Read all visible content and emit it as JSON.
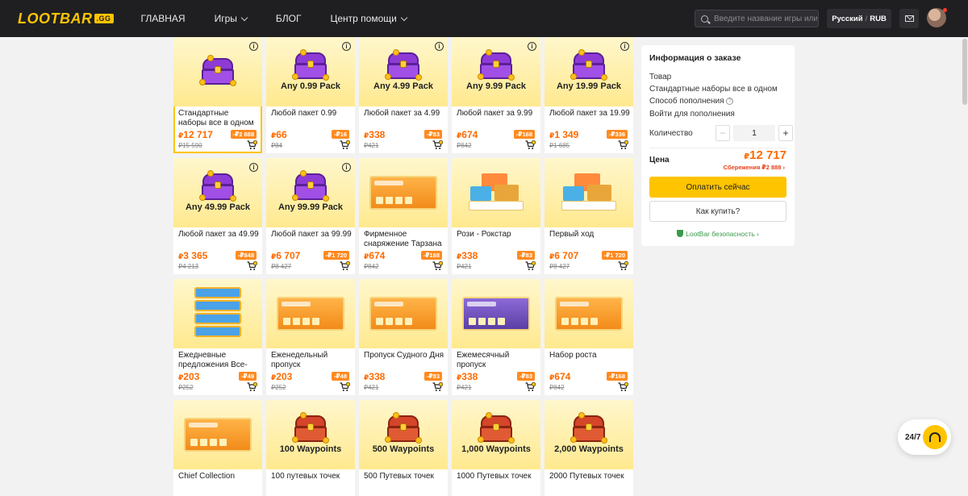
{
  "header": {
    "logo": "LOOTBAR",
    "logo_badge": ".GG",
    "nav": [
      {
        "label": "ГЛАВНАЯ",
        "dropdown": false
      },
      {
        "label": "Игры",
        "dropdown": true
      },
      {
        "label": "БЛОГ",
        "dropdown": false
      },
      {
        "label": "Центр помощи",
        "dropdown": true
      }
    ],
    "search_placeholder": "Введите название игры или тс",
    "language": "Русский",
    "currency": "RUB"
  },
  "products": [
    {
      "name": "Стандартные наборы все в одном",
      "price": "12 717",
      "discount": "-₽2 888",
      "old": "₽15 590",
      "art": "chest",
      "label": "",
      "selected": true
    },
    {
      "name": "Любой пакет 0.99",
      "price": "66",
      "discount": "-₽16",
      "old": "₽84",
      "art": "chest",
      "label": "Any 0.99 Pack"
    },
    {
      "name": "Любой пакет за 4.99",
      "price": "338",
      "discount": "-₽83",
      "old": "₽421",
      "art": "chest",
      "label": "Any 4.99 Pack"
    },
    {
      "name": "Любой пакет за 9.99",
      "price": "674",
      "discount": "-₽168",
      "old": "₽842",
      "art": "chest",
      "label": "Any 9.99 Pack"
    },
    {
      "name": "Любой пакет за 19.99",
      "price": "1 349",
      "discount": "-₽336",
      "old": "₽1 685",
      "art": "chest",
      "label": "Any 19.99 Pack"
    },
    {
      "name": "Любой пакет за 49.99",
      "price": "3 365",
      "discount": "-₽848",
      "old": "₽4 213",
      "art": "chest",
      "label": "Any 49.99 Pack"
    },
    {
      "name": "Любой пакет за 99.99",
      "price": "6 707",
      "discount": "-₽1 720",
      "old": "₽8 427",
      "art": "chest",
      "label": "Any 99.99 Pack"
    },
    {
      "name": "Фирменное снаряжение Тарзана",
      "price": "674",
      "discount": "-₽168",
      "old": "₽842",
      "art": "banner",
      "label": ""
    },
    {
      "name": "Рози - Рокстар",
      "price": "338",
      "discount": "-₽83",
      "old": "₽421",
      "art": "gifts",
      "label": ""
    },
    {
      "name": "Первый ход",
      "price": "6 707",
      "discount": "-₽1 720",
      "old": "₽8 427",
      "art": "gifts",
      "label": ""
    },
    {
      "name": "Ежедневные предложения Все-в-...",
      "price": "203",
      "discount": "-₽49",
      "old": "₽252",
      "art": "daily",
      "label": ""
    },
    {
      "name": "Еженедельный пропуск",
      "price": "203",
      "discount": "-₽48",
      "old": "₽252",
      "art": "banner",
      "label": ""
    },
    {
      "name": "Пропуск Судного Дня",
      "price": "338",
      "discount": "-₽83",
      "old": "₽421",
      "art": "banner",
      "label": ""
    },
    {
      "name": "Ежемесячный пропуск",
      "price": "338",
      "discount": "-₽83",
      "old": "₽421",
      "art": "banner-purple",
      "label": ""
    },
    {
      "name": "Набор роста",
      "price": "674",
      "discount": "-₽168",
      "old": "₽842",
      "art": "banner",
      "label": ""
    },
    {
      "name": "Chief Collection",
      "price": "",
      "discount": "",
      "old": "",
      "art": "banner",
      "label": ""
    },
    {
      "name": "100 путевых точек",
      "price": "",
      "discount": "",
      "old": "",
      "art": "chest-red",
      "label": "100 Waypoints"
    },
    {
      "name": "500 Путевых точек",
      "price": "",
      "discount": "",
      "old": "",
      "art": "chest-red",
      "label": "500 Waypoints"
    },
    {
      "name": "1000 Путевых точек",
      "price": "",
      "discount": "",
      "old": "",
      "art": "chest-red",
      "label": "1,000 Waypoints"
    },
    {
      "name": "2000 Путевых точек",
      "price": "",
      "discount": "",
      "old": "",
      "art": "chest-red",
      "label": "2,000 Waypoints"
    }
  ],
  "currency_symbol": "₽",
  "order": {
    "title": "Информация о заказе",
    "item_label": "Товар",
    "item_value": "Стандартные наборы все в одном",
    "method_label": "Способ пополнения",
    "login_label": "Войти для пополнения",
    "quantity_label": "Количество",
    "quantity": "1",
    "minus": "−",
    "plus": "+",
    "price_label": "Цена",
    "price": "12 717",
    "savings": "Сбережения ₽2 888",
    "pay_button": "Оплатить сейчас",
    "how_button": "Как купить?",
    "safety": "LootBar безопасность"
  },
  "support": {
    "label": "24/7"
  },
  "colors": {
    "accent": "#ffc400",
    "price": "#ff6a00",
    "discount": "#ff8a1f",
    "header": "#1f1f22"
  }
}
